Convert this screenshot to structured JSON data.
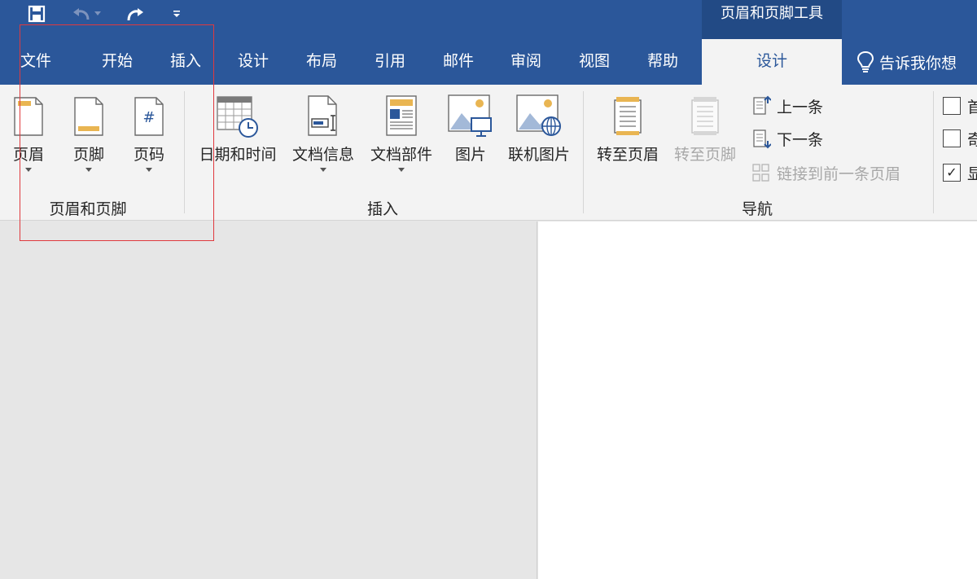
{
  "quick_access": {
    "save_icon": "save-icon",
    "undo_icon": "undo-icon",
    "redo_icon": "redo-icon",
    "customize_icon": "customize-qat-icon"
  },
  "context_group": {
    "title": "页眉和页脚工具"
  },
  "tabs": [
    "文件",
    "开始",
    "插入",
    "设计",
    "布局",
    "引用",
    "邮件",
    "审阅",
    "视图",
    "帮助"
  ],
  "active_tab": "设计",
  "tell_me": {
    "icon": "lightbulb-icon",
    "label": "告诉我你想"
  },
  "ribbon": {
    "group_header_footer": {
      "label": "页眉和页脚",
      "buttons": [
        {
          "label": "页眉",
          "icon": "header-icon"
        },
        {
          "label": "页脚",
          "icon": "footer-icon"
        },
        {
          "label": "页码",
          "icon": "page-number-icon"
        }
      ]
    },
    "group_insert": {
      "label": "插入",
      "buttons": [
        {
          "label": "日期和时间",
          "icon": "date-time-icon"
        },
        {
          "label": "文档信息",
          "icon": "document-info-icon"
        },
        {
          "label": "文档部件",
          "icon": "quick-parts-icon"
        },
        {
          "label": "图片",
          "icon": "picture-icon"
        },
        {
          "label": "联机图片",
          "icon": "online-picture-icon"
        }
      ]
    },
    "group_navigation": {
      "label": "导航",
      "go_to_header": "转至页眉",
      "go_to_footer": "转至页脚",
      "previous": "上一条",
      "next": "下一条",
      "link_to_previous": "链接到前一条页眉"
    },
    "options": {
      "items": [
        {
          "label": "首",
          "checked": false
        },
        {
          "label": "奇",
          "checked": false
        },
        {
          "label": "显",
          "checked": true
        }
      ]
    }
  },
  "colors": {
    "title_bar": "#2b579a",
    "context_group": "#224a85",
    "ribbon": "#f3f3f3",
    "highlight_box": "#e0393e"
  }
}
